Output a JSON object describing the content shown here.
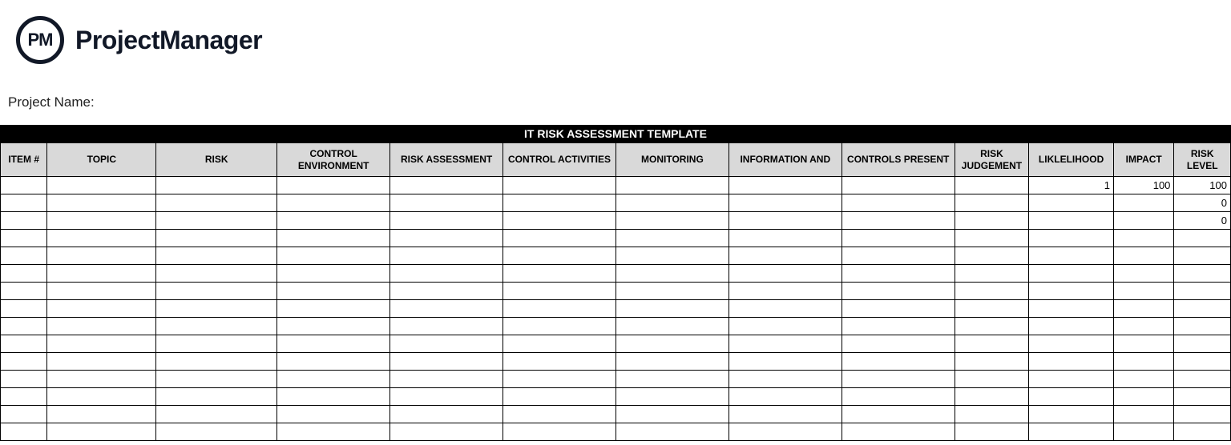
{
  "header": {
    "logo_abbrev": "PM",
    "brand": "ProjectManager",
    "project_name_label": "Project Name:"
  },
  "table": {
    "title": "IT RISK ASSESSMENT TEMPLATE",
    "columns": [
      "ITEM #",
      "TOPIC",
      "RISK",
      "CONTROL ENVIRONMENT",
      "RISK ASSESSMENT",
      "CONTROL ACTIVITIES",
      "MONITORING",
      "INFORMATION AND",
      "CONTROLS PRESENT",
      "RISK JUDGEMENT",
      "LIKLELIHOOD",
      "IMPACT",
      "RISK LEVEL"
    ],
    "rows": [
      {
        "item": "",
        "topic": "",
        "risk": "",
        "ctrl_env": "",
        "risk_assess": "",
        "ctrl_act": "",
        "monitoring": "",
        "info": "",
        "ctrls_present": "",
        "risk_judge": "",
        "likelihood": "1",
        "impact": "100",
        "risk_level": "100"
      },
      {
        "item": "",
        "topic": "",
        "risk": "",
        "ctrl_env": "",
        "risk_assess": "",
        "ctrl_act": "",
        "monitoring": "",
        "info": "",
        "ctrls_present": "",
        "risk_judge": "",
        "likelihood": "",
        "impact": "",
        "risk_level": "0"
      },
      {
        "item": "",
        "topic": "",
        "risk": "",
        "ctrl_env": "",
        "risk_assess": "",
        "ctrl_act": "",
        "monitoring": "",
        "info": "",
        "ctrls_present": "",
        "risk_judge": "",
        "likelihood": "",
        "impact": "",
        "risk_level": "0"
      },
      {
        "item": "",
        "topic": "",
        "risk": "",
        "ctrl_env": "",
        "risk_assess": "",
        "ctrl_act": "",
        "monitoring": "",
        "info": "",
        "ctrls_present": "",
        "risk_judge": "",
        "likelihood": "",
        "impact": "",
        "risk_level": ""
      },
      {
        "item": "",
        "topic": "",
        "risk": "",
        "ctrl_env": "",
        "risk_assess": "",
        "ctrl_act": "",
        "monitoring": "",
        "info": "",
        "ctrls_present": "",
        "risk_judge": "",
        "likelihood": "",
        "impact": "",
        "risk_level": ""
      },
      {
        "item": "",
        "topic": "",
        "risk": "",
        "ctrl_env": "",
        "risk_assess": "",
        "ctrl_act": "",
        "monitoring": "",
        "info": "",
        "ctrls_present": "",
        "risk_judge": "",
        "likelihood": "",
        "impact": "",
        "risk_level": ""
      },
      {
        "item": "",
        "topic": "",
        "risk": "",
        "ctrl_env": "",
        "risk_assess": "",
        "ctrl_act": "",
        "monitoring": "",
        "info": "",
        "ctrls_present": "",
        "risk_judge": "",
        "likelihood": "",
        "impact": "",
        "risk_level": ""
      },
      {
        "item": "",
        "topic": "",
        "risk": "",
        "ctrl_env": "",
        "risk_assess": "",
        "ctrl_act": "",
        "monitoring": "",
        "info": "",
        "ctrls_present": "",
        "risk_judge": "",
        "likelihood": "",
        "impact": "",
        "risk_level": ""
      },
      {
        "item": "",
        "topic": "",
        "risk": "",
        "ctrl_env": "",
        "risk_assess": "",
        "ctrl_act": "",
        "monitoring": "",
        "info": "",
        "ctrls_present": "",
        "risk_judge": "",
        "likelihood": "",
        "impact": "",
        "risk_level": ""
      },
      {
        "item": "",
        "topic": "",
        "risk": "",
        "ctrl_env": "",
        "risk_assess": "",
        "ctrl_act": "",
        "monitoring": "",
        "info": "",
        "ctrls_present": "",
        "risk_judge": "",
        "likelihood": "",
        "impact": "",
        "risk_level": ""
      },
      {
        "item": "",
        "topic": "",
        "risk": "",
        "ctrl_env": "",
        "risk_assess": "",
        "ctrl_act": "",
        "monitoring": "",
        "info": "",
        "ctrls_present": "",
        "risk_judge": "",
        "likelihood": "",
        "impact": "",
        "risk_level": ""
      },
      {
        "item": "",
        "topic": "",
        "risk": "",
        "ctrl_env": "",
        "risk_assess": "",
        "ctrl_act": "",
        "monitoring": "",
        "info": "",
        "ctrls_present": "",
        "risk_judge": "",
        "likelihood": "",
        "impact": "",
        "risk_level": ""
      },
      {
        "item": "",
        "topic": "",
        "risk": "",
        "ctrl_env": "",
        "risk_assess": "",
        "ctrl_act": "",
        "monitoring": "",
        "info": "",
        "ctrls_present": "",
        "risk_judge": "",
        "likelihood": "",
        "impact": "",
        "risk_level": ""
      },
      {
        "item": "",
        "topic": "",
        "risk": "",
        "ctrl_env": "",
        "risk_assess": "",
        "ctrl_act": "",
        "monitoring": "",
        "info": "",
        "ctrls_present": "",
        "risk_judge": "",
        "likelihood": "",
        "impact": "",
        "risk_level": ""
      },
      {
        "item": "",
        "topic": "",
        "risk": "",
        "ctrl_env": "",
        "risk_assess": "",
        "ctrl_act": "",
        "monitoring": "",
        "info": "",
        "ctrls_present": "",
        "risk_judge": "",
        "likelihood": "",
        "impact": "",
        "risk_level": ""
      }
    ]
  }
}
